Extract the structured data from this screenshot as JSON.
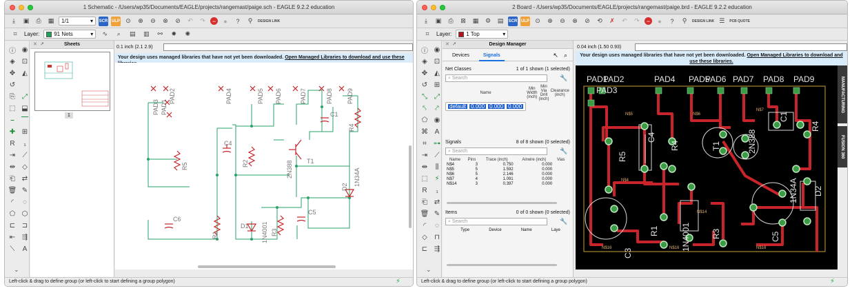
{
  "schematic": {
    "title": "1 Schematic - /Users/wp35/Documents/EAGLE/projects/rangemast/paige.sch - EAGLE 9.2.2 education",
    "sheet_selector": "1/1",
    "layer_label": "Layer:",
    "layer_value": "91 Nets",
    "sheets_title": "Sheets",
    "sheet_number": "1",
    "coordinate": "0.1 inch (2.1 2.9)",
    "info_text": "Your design uses managed libraries that have not yet been downloaded.",
    "info_link": "Open Managed Libraries to download and use these libraries.",
    "status": "Left-click & drag to define group (or left-click to start defining a group polygon)",
    "design_link_label": "DESIGN LINK",
    "part_labels": {
      "pad1": "PAD1",
      "pad2": "PAD2",
      "pad3": "PAD3",
      "pad4": "PAD4",
      "pad5": "PAD5",
      "pad6": "PAD6",
      "pad7": "PAD7",
      "pad8": "PAD8",
      "pad9": "PAD9",
      "c1": "C1",
      "c4": "C4",
      "c5": "C5",
      "c6": "C6",
      "r1": "R1",
      "r2": "R2",
      "r3": "R3",
      "r4": "R4",
      "r5": "R5",
      "t1": "T1",
      "d1": "D1",
      "d2": "D2",
      "t1_value": "2N388",
      "d1_value": "1N4001",
      "d2_value": "1N34A"
    }
  },
  "board": {
    "title": "2 Board - /Users/wp35/Documents/EAGLE/projects/rangemast/paige.brd - EAGLE 9.2.2 education",
    "layer_label": "Layer:",
    "layer_value": "1 Top",
    "coordinate": "0.04 inch (1.50 0.93)",
    "info_text": "Your design uses managed libraries that have not yet been downloaded.",
    "info_link": "Open Managed Libraries to download and use these libraries.",
    "status": "Left-click & drag to define group (or left-click to start defining a group polygon)",
    "side_tabs": [
      "MANUFACTURING",
      "FUSION 360"
    ],
    "toolbar_links": [
      "DESIGN LINK",
      "PCB QUOTE"
    ],
    "design_manager": {
      "title": "Design Manager",
      "tabs": [
        "Devices",
        "Signals"
      ],
      "active_tab": "Signals",
      "net_classes": {
        "label": "Net Classes",
        "count": "1 of 1 shown (1 selected)",
        "search_placeholder": "Search",
        "columns": [
          "Name",
          "Min Width (inch)",
          "Min Via Drill (inch)",
          "Clearance (inch)"
        ],
        "rows": [
          [
            "default",
            "0.000",
            "0.000",
            "0.000"
          ]
        ]
      },
      "signals": {
        "label": "Signals",
        "count": "8 of 8 shown (0 selected)",
        "search_placeholder": "Search",
        "columns": [
          "Name",
          "Pins",
          "Trace (inch)",
          "Airwire (inch)",
          "Vias"
        ],
        "rows": [
          [
            "N$4",
            "3",
            "0.750",
            "0.000"
          ],
          [
            "N$5",
            "5",
            "1.592",
            "0.000"
          ],
          [
            "N$6",
            "5",
            "2.146",
            "0.000"
          ],
          [
            "N$7",
            "4",
            "1.091",
            "0.000"
          ],
          [
            "N$14",
            "3",
            "0.397",
            "0.000"
          ]
        ]
      },
      "items": {
        "label": "Items",
        "count": "0 of 0 shown (0 selected)",
        "search_placeholder": "Search",
        "columns": [
          "Type",
          "Device",
          "Name",
          "Laye"
        ]
      }
    },
    "part_labels": {
      "pad1": "PAD1",
      "pad2": "PAD2",
      "pad3": "PAD3",
      "pad4": "PAD4",
      "pad5": "PAD5",
      "pad6": "PAD6",
      "pad7": "PAD7",
      "pad8": "PAD8",
      "pad9": "PAD9",
      "c1": "C1",
      "c3": "C3",
      "c4": "C4",
      "c5": "C5",
      "r1": "R1",
      "r3": "R3",
      "r4": "R4",
      "r5": "R5",
      "t1": "T1",
      "d1_value": "1N4001",
      "d2": "D2",
      "d2_value": "1N34A",
      "t1_value": "2N388",
      "n5": "N$5",
      "n6": "N$6",
      "n7": "N$7",
      "n4": "N$4",
      "n14": "N$14",
      "n16": "N$16"
    }
  }
}
